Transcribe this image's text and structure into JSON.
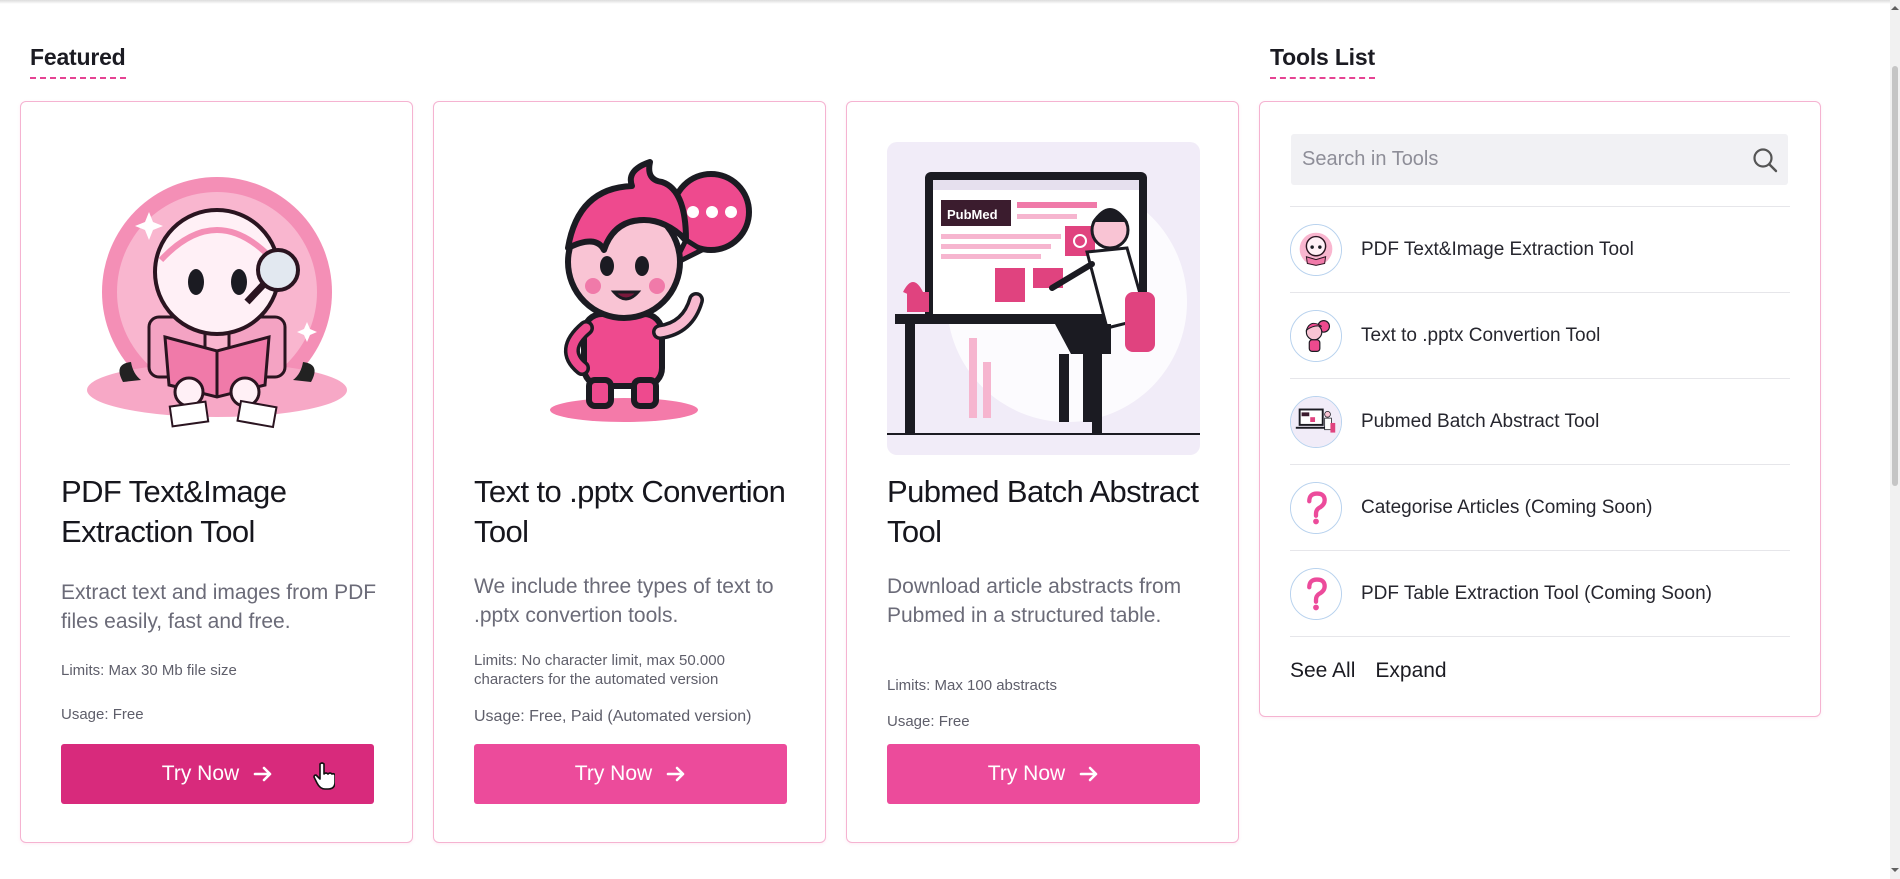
{
  "featured": {
    "title": "Featured",
    "cards": [
      {
        "title": "PDF Text&Image Extraction Tool",
        "description": "Extract text and images from PDF files easily, fast and free.",
        "limits": "Limits: Max 30 Mb file size",
        "usage": "Usage: Free",
        "button_label": "Try Now",
        "image_icon": "robot-reading-book-illustration"
      },
      {
        "title": "Text to .pptx Convertion Tool",
        "description": "We include three types of text to .pptx convertion tools.",
        "limits": "Limits: No character limit, max 50.000 characters for the automated version",
        "usage": "Usage: Free, Paid (Automated version)",
        "button_label": "Try Now",
        "image_icon": "cartoon-boy-speech-bubble-illustration"
      },
      {
        "title": "Pubmed Batch Abstract Tool",
        "description": "Download article abstracts from Pubmed in a structured table.",
        "limits": "Limits: Max 100 abstracts",
        "usage": "Usage: Free",
        "button_label": "Try Now",
        "image_icon": "scientist-at-computer-illustration",
        "image_text": "PubMed"
      }
    ]
  },
  "tools_list": {
    "title": "Tools List",
    "search_placeholder": "Search in Tools",
    "items": [
      {
        "label": "PDF Text&Image Extraction Tool",
        "icon": "robot-avatar"
      },
      {
        "label": "Text to .pptx Convertion Tool",
        "icon": "cartoon-boy-avatar"
      },
      {
        "label": "Pubmed Batch Abstract Tool",
        "icon": "scientist-avatar"
      },
      {
        "label": "Categorise Articles (Coming Soon)",
        "icon": "question-mark-icon"
      },
      {
        "label": "PDF Table Extraction Tool (Coming Soon)",
        "icon": "question-mark-icon"
      }
    ],
    "see_all_label": "See All",
    "expand_label": "Expand"
  },
  "colors": {
    "accent": "#ec4b9b",
    "accent_hover": "#d82a7c",
    "card_border": "#f5b3d1",
    "heading_underline": "#e54393"
  }
}
